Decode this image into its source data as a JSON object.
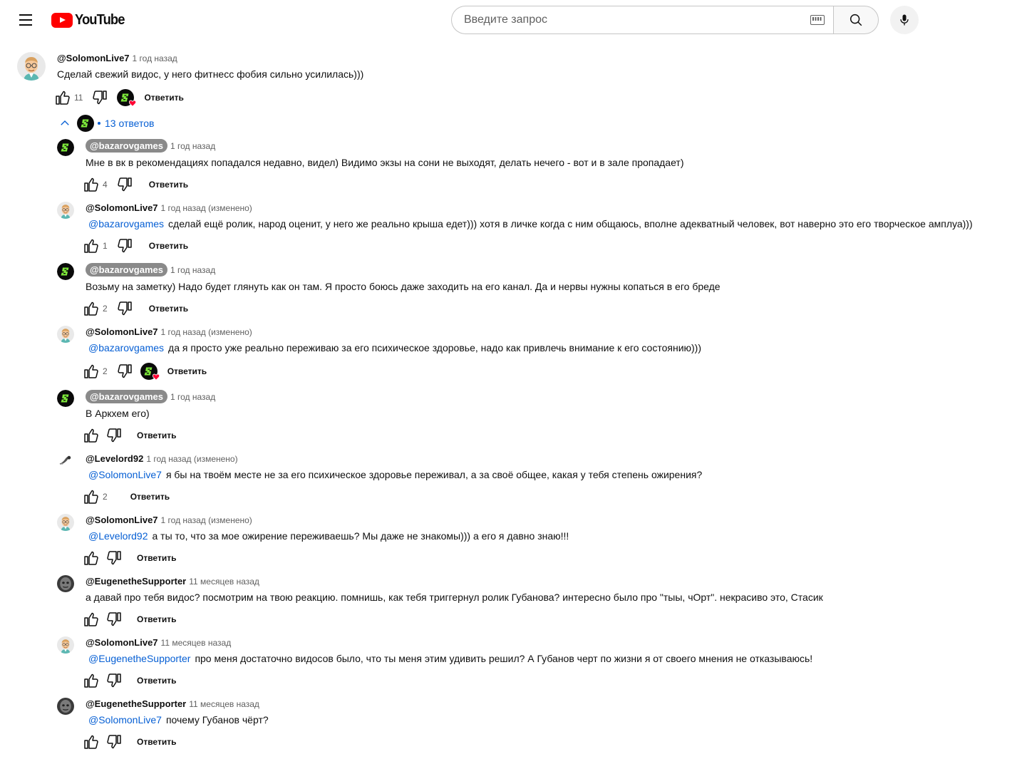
{
  "header": {
    "logo_text": "YouTube",
    "search_placeholder": "Введите запрос"
  },
  "top_comment": {
    "author": "@SolomonLive7",
    "time": "1 год назад",
    "text": "Сделай свежий видос, у него фитнесс фобия сильно усилилась)))",
    "likes": "11",
    "reply_label": "Ответить",
    "replies_label": "13 ответов"
  },
  "replies": [
    {
      "author": "@bazarovgames",
      "time": "1 год назад",
      "mention": "",
      "text": "Мне в вк в рекомендациях попадался недавно, видел) Видимо экзы на сони не выходят, делать нечего - вот и в зале пропадает)",
      "likes": "4",
      "reply_label": "Ответить"
    },
    {
      "author": "@SolomonLive7",
      "time": "1 год назад (изменено)",
      "mention": "@bazarovgames",
      "text": "сделай ещё ролик, народ оценит, у него же реально крыша едет))) хотя в личке когда с ним общаюсь, вполне адекватный человек, вот наверно это его творческое амплуа)))",
      "likes": "1",
      "reply_label": "Ответить"
    },
    {
      "author": "@bazarovgames",
      "time": "1 год назад",
      "mention": "",
      "text": "Возьму на заметку) Надо будет глянуть как он там. Я просто боюсь даже заходить на его канал. Да и нервы нужны копаться в его бреде",
      "likes": "2",
      "reply_label": "Ответить"
    },
    {
      "author": "@SolomonLive7",
      "time": "1 год назад (изменено)",
      "mention": "@bazarovgames",
      "text": "да я просто уже реально переживаю за его психическое здоровье, надо как привлечь внимание к его состоянию)))",
      "likes": "2",
      "reply_label": "Ответить"
    },
    {
      "author": "@bazarovgames",
      "time": "1 год назад",
      "mention": "",
      "text": "В Аркхем его)",
      "likes": "",
      "reply_label": "Ответить"
    },
    {
      "author": "@Levelord92",
      "time": "1 год назад (изменено)",
      "mention": "@SolomonLive7",
      "text": "я бы на твоём месте не за его психическое здоровье переживал, а за своё общее, какая у тебя степень ожирения?",
      "likes": "2",
      "reply_label": "Ответить"
    },
    {
      "author": "@SolomonLive7",
      "time": "1 год назад (изменено)",
      "mention": "@Levelord92",
      "text": "а ты то, что за мое ожирение переживаешь? Мы даже не знакомы))) а его я давно знаю!!!",
      "likes": "",
      "reply_label": "Ответить"
    },
    {
      "author": "@EugenetheSupporter",
      "time": "11 месяцев назад",
      "mention": "",
      "text": "а давай про тебя видос? посмотрим на твою реакцию. помнишь, как тебя триггернул ролик Губанова? интересно было про \"тыы, чОрт\". некрасиво это, Стасик",
      "likes": "",
      "reply_label": "Ответить"
    },
    {
      "author": "@SolomonLive7",
      "time": "11 месяцев назад",
      "mention": "@EugenetheSupporter",
      "text": "про меня достаточно видосов было, что ты меня этим удивить решил? А Губанов черт по жизни я от своего мнения не отказываюсь!",
      "likes": "",
      "reply_label": "Ответить"
    },
    {
      "author": "@EugenetheSupporter",
      "time": "11 месяцев назад",
      "mention": "@SolomonLive7",
      "text": "почему Губанов чёрт?",
      "likes": "",
      "reply_label": "Ответить"
    }
  ]
}
